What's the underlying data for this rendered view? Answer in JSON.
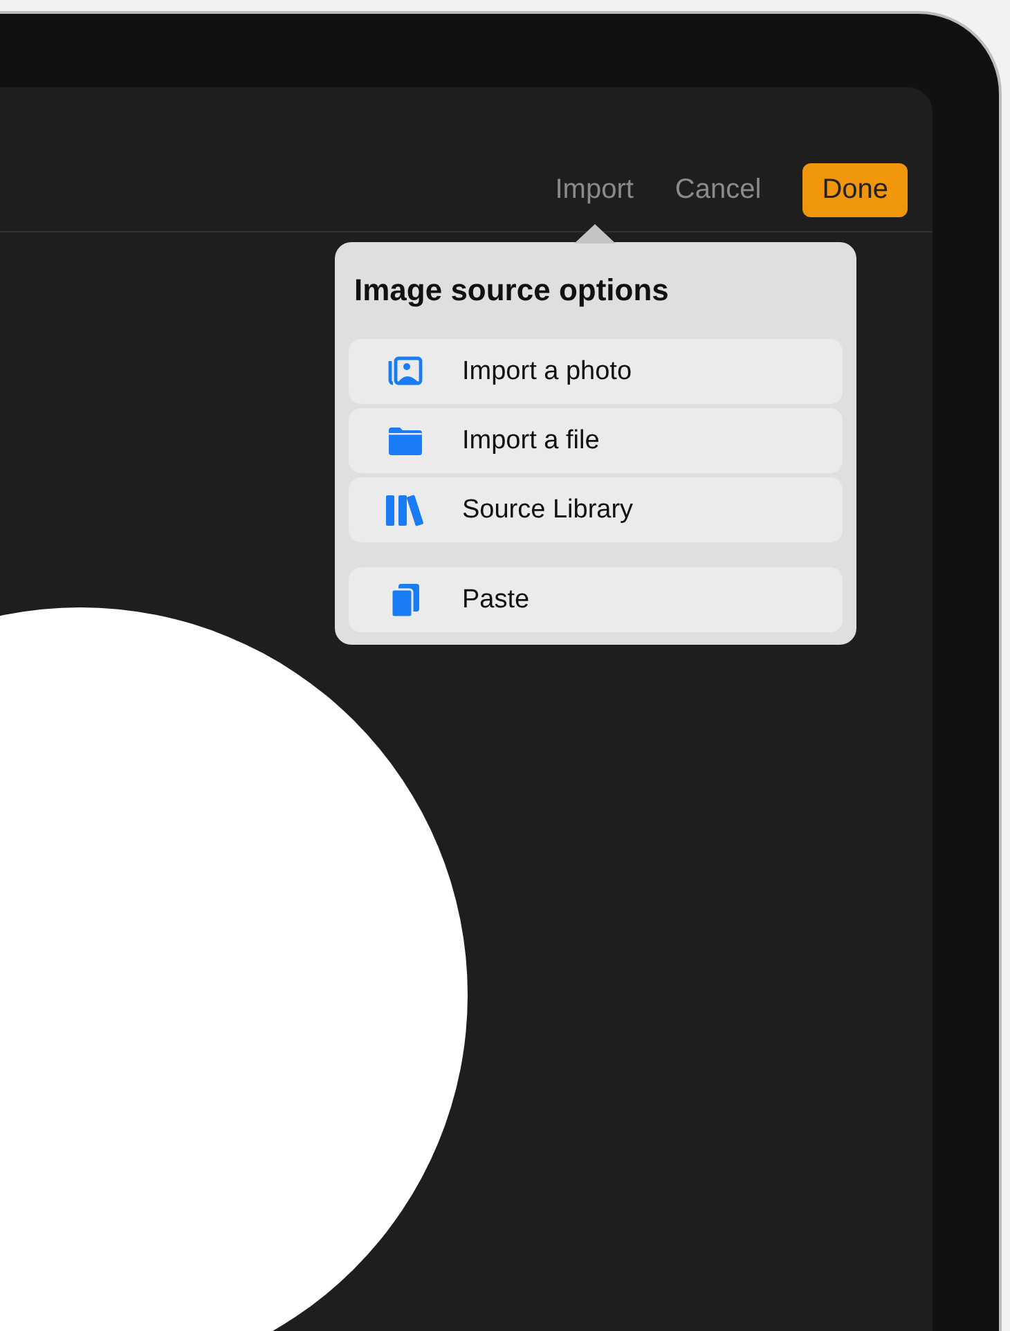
{
  "toolbar": {
    "buttons": [
      {
        "label": "Import",
        "kind": "plain"
      },
      {
        "label": "Cancel",
        "kind": "plain"
      },
      {
        "label": "Done",
        "kind": "primary"
      }
    ]
  },
  "popover": {
    "title": "Image source options",
    "groups": [
      [
        {
          "label": "Import a photo"
        },
        {
          "label": "Import a file"
        },
        {
          "label": "Source Library"
        }
      ],
      [
        {
          "label": "Paste"
        }
      ]
    ]
  }
}
